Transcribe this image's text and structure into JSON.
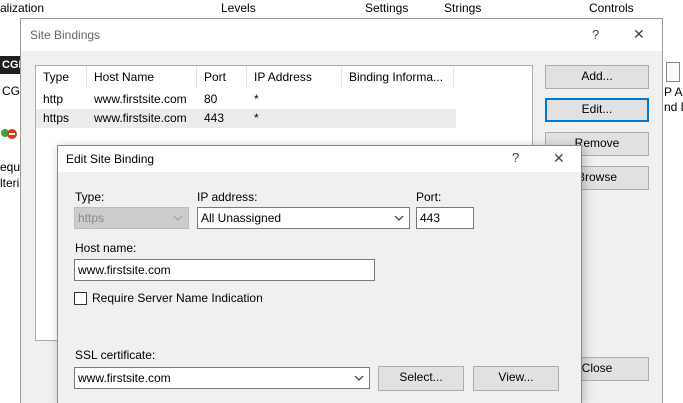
{
  "background": {
    "tabs": [
      "alization",
      "Levels",
      "Settings",
      "Strings",
      "Controls"
    ],
    "left_fragments": [
      "CGI",
      "CGI",
      "eque",
      "lteri"
    ],
    "right_fragments": [
      "P Ac",
      "nd D"
    ]
  },
  "site_bindings": {
    "title": "Site Bindings",
    "help_glyph": "?",
    "close_glyph": "✕",
    "columns": [
      "Type",
      "Host Name",
      "Port",
      "IP Address",
      "Binding Informa..."
    ],
    "rows": [
      {
        "type": "http",
        "host": "www.firstsite.com",
        "port": "80",
        "ip": "*",
        "info": ""
      },
      {
        "type": "https",
        "host": "www.firstsite.com",
        "port": "443",
        "ip": "*",
        "info": ""
      }
    ],
    "buttons": {
      "add": "Add...",
      "edit": "Edit...",
      "remove": "Remove",
      "browse": "Browse",
      "close": "Close"
    }
  },
  "edit_binding": {
    "title": "Edit Site Binding",
    "help_glyph": "?",
    "close_glyph": "✕",
    "type_label": "Type:",
    "type_value": "https",
    "ip_label": "IP address:",
    "ip_value": "All Unassigned",
    "port_label": "Port:",
    "port_value": "443",
    "host_label": "Host name:",
    "host_value": "www.firstsite.com",
    "sni_label": "Require Server Name Indication",
    "sni_checked": false,
    "ssl_label": "SSL certificate:",
    "ssl_value": "www.firstsite.com",
    "select_button": "Select...",
    "view_button": "View..."
  },
  "colors": {
    "focus_border": "#0078d7",
    "selected_row": "#ececec",
    "disabled_field": "#cccccc"
  }
}
